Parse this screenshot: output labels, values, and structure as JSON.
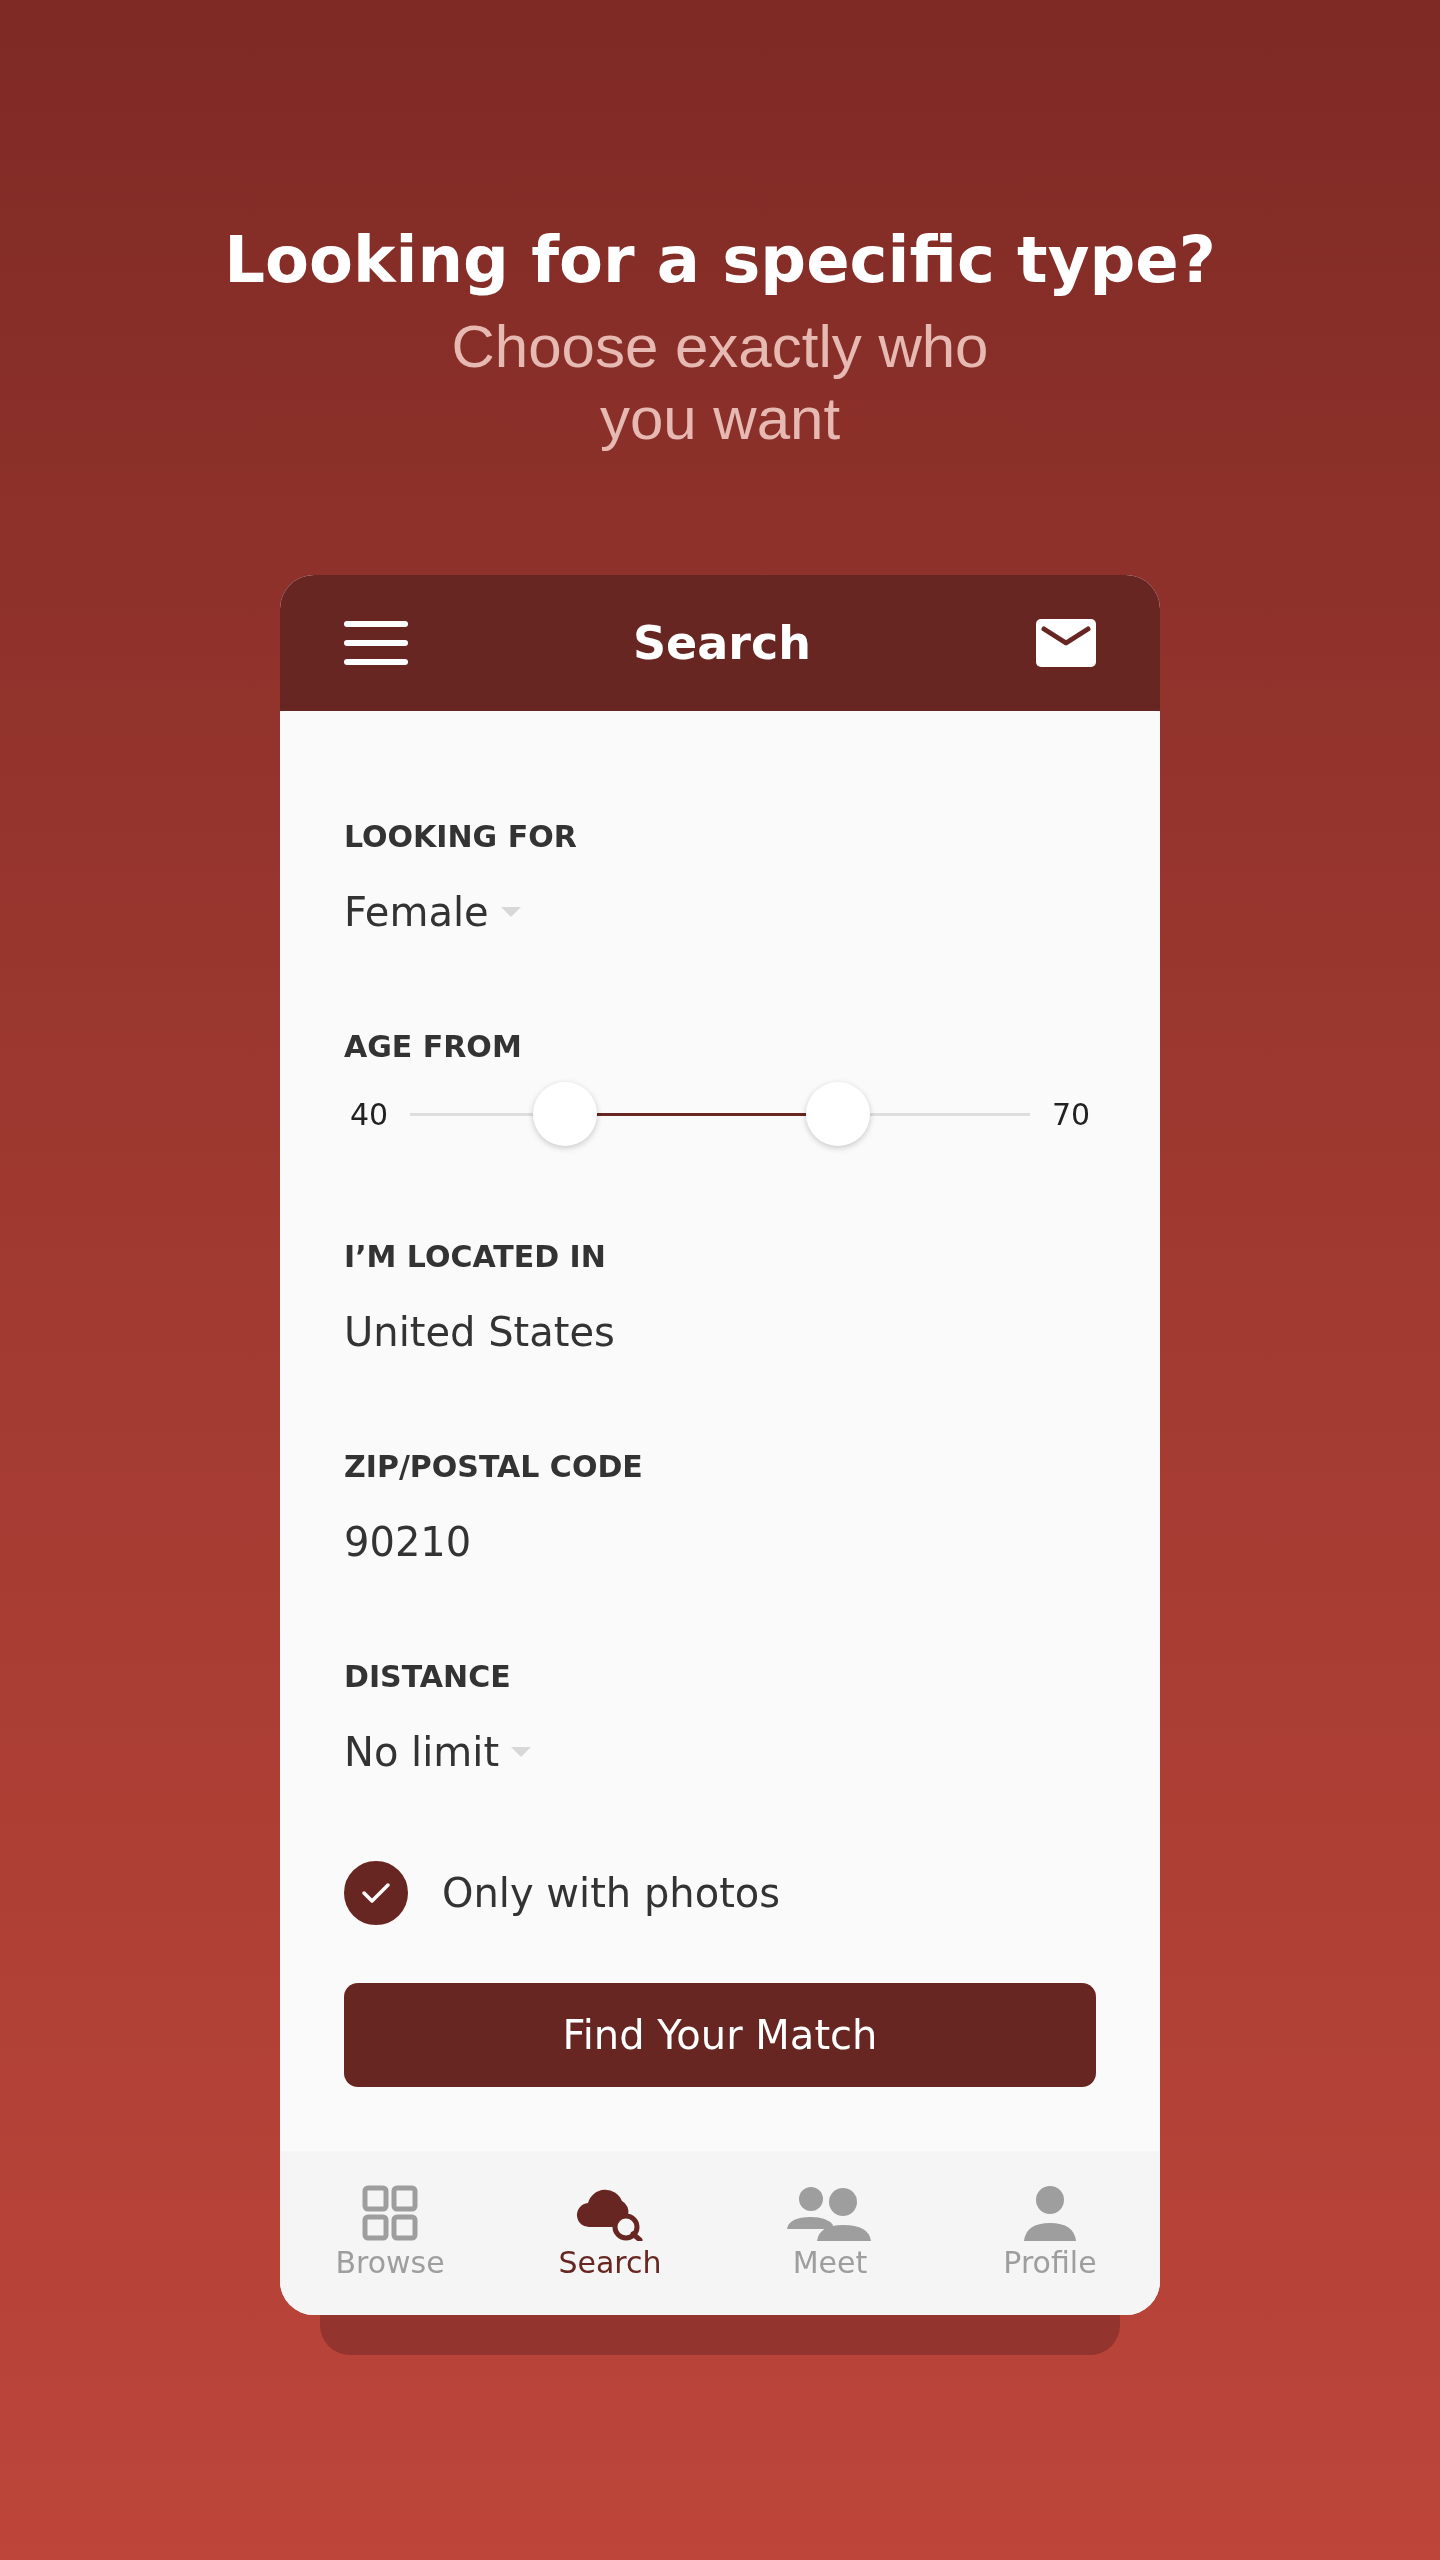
{
  "headline": "Looking for a specific type?",
  "subheadline": "Choose exactly who you want",
  "app_bar": {
    "title": "Search"
  },
  "fields": [
    {
      "kind": "dropdown",
      "label": "LOOKING FOR",
      "value": "Female"
    },
    {
      "kind": "range",
      "label": "AGE FROM",
      "min_label": "40",
      "max_label": "70",
      "thumbs": [
        {
          "level": 0.25
        },
        {
          "level": 0.69
        }
      ]
    },
    {
      "kind": "text",
      "label": "I’M LOCATED IN",
      "value": "United States"
    },
    {
      "kind": "text",
      "label": "ZIP/POSTAL CODE",
      "value": "90210"
    },
    {
      "kind": "dropdown",
      "label": "DISTANCE",
      "value": "No limit"
    }
  ],
  "photo_filter": {
    "label": "Only with photos",
    "checked": true
  },
  "submit_button": "Find Your Match",
  "bottom_nav": [
    {
      "kind": "browse",
      "label": "Browse",
      "selected": false
    },
    {
      "kind": "search",
      "label": "Search",
      "selected": true
    },
    {
      "kind": "meet",
      "label": "Meet",
      "selected": false
    },
    {
      "kind": "profile",
      "label": "Profile",
      "selected": false
    }
  ]
}
